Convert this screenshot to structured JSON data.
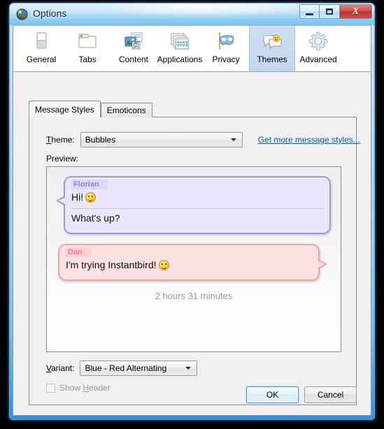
{
  "window": {
    "title": "Options",
    "icon": "instantbird-icon",
    "buttons": {
      "minimize": "minimize-icon",
      "maximize": "maximize-icon",
      "close": "X"
    }
  },
  "toolbar": {
    "items": [
      {
        "label": "General",
        "icon": "general-icon",
        "selected": false
      },
      {
        "label": "Tabs",
        "icon": "tabs-icon",
        "selected": false
      },
      {
        "label": "Content",
        "icon": "content-icon",
        "selected": false
      },
      {
        "label": "Applications",
        "icon": "applications-icon",
        "selected": false
      },
      {
        "label": "Privacy",
        "icon": "privacy-mask-icon",
        "selected": false
      },
      {
        "label": "Themes",
        "icon": "themes-icon",
        "selected": true
      },
      {
        "label": "Advanced",
        "icon": "advanced-gear-icon",
        "selected": false
      }
    ]
  },
  "tabs": [
    {
      "label": "Message Styles",
      "active": true
    },
    {
      "label": "Emoticons",
      "active": false
    }
  ],
  "theme": {
    "label_prefix": "T",
    "label_rest": "heme:",
    "value": "Bubbles",
    "options": [
      "Bubbles"
    ],
    "link": "Get more message styles..."
  },
  "preview": {
    "label": "Preview:",
    "messages": [
      {
        "sender": "Florian",
        "direction": "incoming",
        "lines": [
          "Hi!",
          "What's up?"
        ],
        "emoji_on_line": 0
      },
      {
        "sender": "Dan",
        "direction": "outgoing",
        "lines": [
          "I'm trying Instantbird!"
        ],
        "emoji_on_line": 0
      }
    ],
    "session_timestamp": "2 hours 31 minutes"
  },
  "variant": {
    "label_prefix": "V",
    "label_rest": "ariant:",
    "value": "Blue - Red Alternating",
    "options": [
      "Blue - Red Alternating"
    ]
  },
  "show_header": {
    "label_pre": "Show ",
    "label_key": "H",
    "label_post": "eader",
    "checked": false,
    "enabled": false
  },
  "footer": {
    "ok": "OK",
    "cancel": "Cancel"
  },
  "colors": {
    "accent": "#3c9adc",
    "link": "#0b58a8",
    "incoming_bubble": "#e8e7fc",
    "incoming_border": "#9c97ec",
    "outgoing_bubble": "#fde1e3",
    "outgoing_border": "#f4a1a6",
    "selected_tab": "#c8dcf0"
  }
}
